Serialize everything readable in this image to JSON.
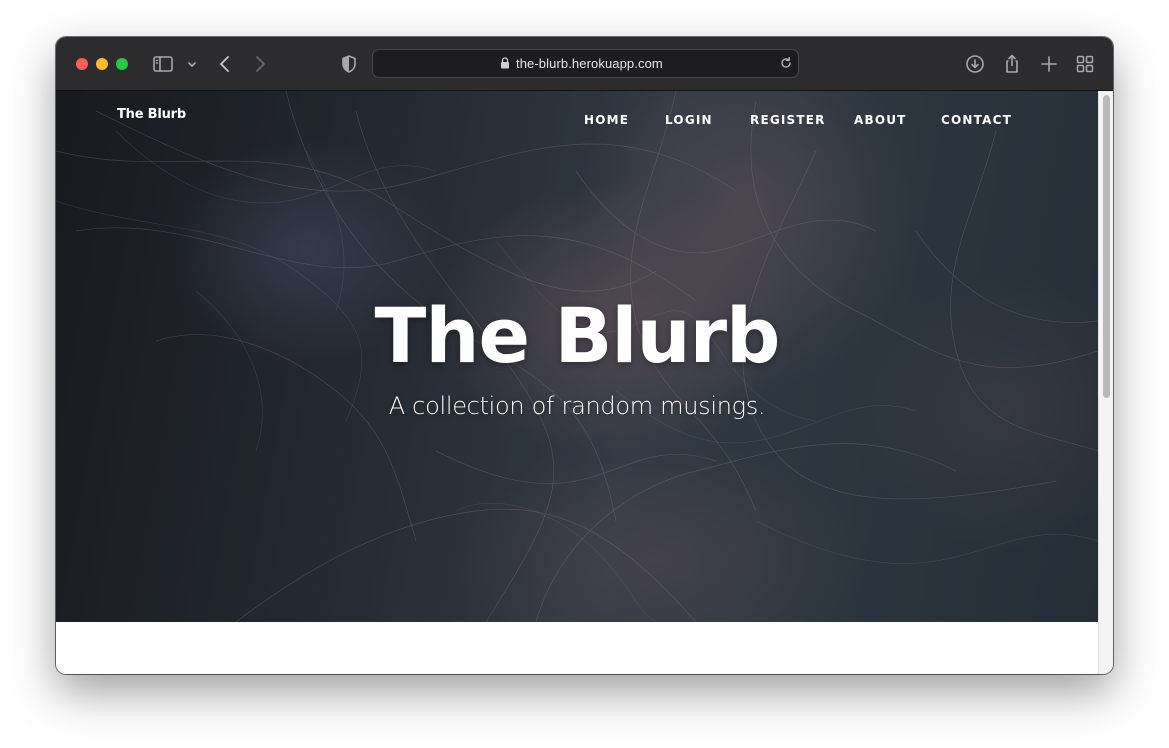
{
  "browser": {
    "url": "the-blurb.herokuapp.com",
    "icons": {
      "sidebar": "sidebar-icon",
      "sidebar_menu": "chevron-down-icon",
      "back": "chevron-left-icon",
      "forward": "chevron-right-icon",
      "privacy": "shield-icon",
      "lock": "lock-icon",
      "reload": "reload-icon",
      "downloads": "download-icon",
      "share": "share-icon",
      "new_tab": "plus-icon",
      "tab_overview": "grid-icon"
    },
    "colors": {
      "close": "#fe5f57",
      "minimize": "#febc2e",
      "maximize": "#28c840",
      "toolbar": "#2c2c2e"
    }
  },
  "site": {
    "brand": "The Blurb",
    "nav": [
      {
        "label": "HOME"
      },
      {
        "label": "LOGIN"
      },
      {
        "label": "REGISTER"
      },
      {
        "label": "ABOUT"
      },
      {
        "label": "CONTACT"
      }
    ],
    "hero": {
      "title": "The Blurb",
      "subtitle": "A collection of random musings."
    }
  }
}
